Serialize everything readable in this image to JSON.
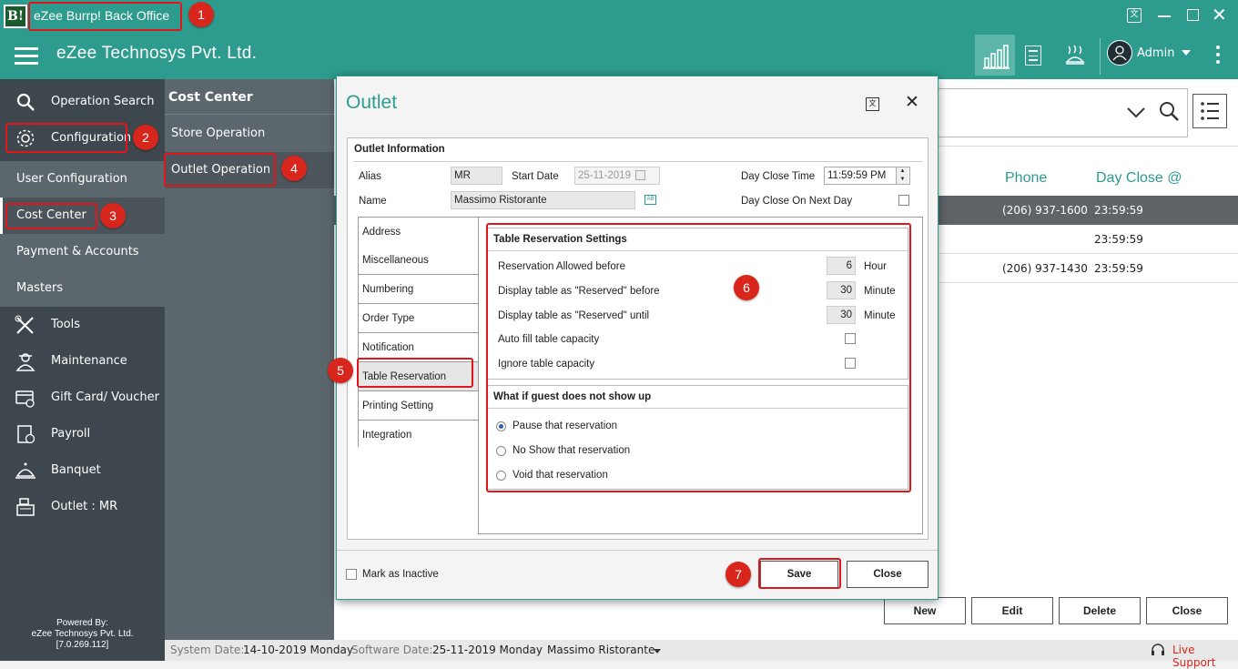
{
  "window": {
    "title": "eZee Burrp! Back Office",
    "logo_text": "B!"
  },
  "appbar": {
    "company": "eZee Technosys Pvt. Ltd.",
    "user": "Admin"
  },
  "sidebar": {
    "items": [
      {
        "label": "Operation Search"
      },
      {
        "label": "Configuration"
      },
      {
        "label": "User Configuration"
      },
      {
        "label": "Cost Center"
      },
      {
        "label": "Payment & Accounts"
      },
      {
        "label": "Masters"
      },
      {
        "label": "Tools"
      },
      {
        "label": "Maintenance"
      },
      {
        "label": "Gift Card/ Voucher"
      },
      {
        "label": "Payroll"
      },
      {
        "label": "Banquet"
      },
      {
        "label": "Outlet : MR"
      }
    ],
    "footer": {
      "line1": "Powered By:",
      "line2": "eZee Technosys Pvt. Ltd.",
      "line3": "[7.0.269.112]"
    }
  },
  "subnav": {
    "title": "Cost Center",
    "items": [
      {
        "label": "Store Operation"
      },
      {
        "label": "Outlet Operation"
      }
    ]
  },
  "content": {
    "columns": {
      "phone": "Phone",
      "day_close": "Day Close @"
    },
    "rows": [
      {
        "phone": "(206) 937-1600",
        "day_close": "23:59:59"
      },
      {
        "phone": "",
        "day_close": "23:59:59"
      },
      {
        "phone": "(206) 937-1430",
        "day_close": "23:59:59"
      }
    ],
    "buttons": {
      "new": "New",
      "edit": "Edit",
      "delete": "Delete",
      "close": "Close"
    }
  },
  "statusbar": {
    "system_date_label": "System Date:",
    "system_date": "14-10-2019 Monday",
    "software_date_label": "Software Date:",
    "software_date": "25-11-2019 Monday",
    "outlet": "Massimo Ristorante",
    "live_support": "Live Support"
  },
  "dialog": {
    "title": "Outlet",
    "section_title": "Outlet Information",
    "alias_label": "Alias",
    "alias_value": "MR",
    "start_date_label": "Start Date",
    "start_date_value": "25-11-2019",
    "day_close_time_label": "Day Close Time",
    "day_close_time_value": "11:59:59 PM",
    "name_label": "Name",
    "name_value": "Massimo Ristorante",
    "day_close_next_label": "Day Close On Next Day",
    "tabs": [
      {
        "label": "Address"
      },
      {
        "label": "Miscellaneous"
      },
      {
        "label": "Numbering"
      },
      {
        "label": "Order Type"
      },
      {
        "label": "Notification"
      },
      {
        "label": "Table Reservation"
      },
      {
        "label": "Printing Setting"
      },
      {
        "label": "Integration"
      }
    ],
    "table_reservation": {
      "title": "Table Reservation Settings",
      "allowed_before_label": "Reservation Allowed before",
      "allowed_before_value": "6",
      "allowed_before_unit": "Hour",
      "reserved_before_label": "Display table as \"Reserved\" before",
      "reserved_before_value": "30",
      "reserved_before_unit": "Minute",
      "reserved_until_label": "Display table as \"Reserved\" until",
      "reserved_until_value": "30",
      "reserved_until_unit": "Minute",
      "auto_fill_label": "Auto fill table capacity",
      "ignore_label": "Ignore table capacity"
    },
    "no_show": {
      "title": "What if guest does not show up",
      "options": [
        {
          "label": "Pause that reservation",
          "selected": true
        },
        {
          "label": "No Show that reservation",
          "selected": false
        },
        {
          "label": "Void that reservation",
          "selected": false
        }
      ]
    },
    "mark_inactive_label": "Mark as Inactive",
    "save_label": "Save",
    "close_label": "Close"
  },
  "badges": {
    "b1": "1",
    "b2": "2",
    "b3": "3",
    "b4": "4",
    "b5": "5",
    "b6": "6",
    "b7": "7"
  },
  "colors": {
    "teal": "#2d9c8e",
    "sidebar": "#3e474d",
    "subnav": "#5c676d",
    "highlight": "#e0161b",
    "badge": "#d9261c"
  }
}
